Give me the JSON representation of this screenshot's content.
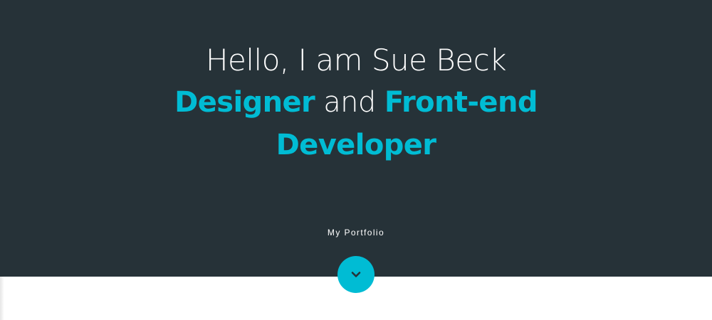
{
  "hero": {
    "greeting": "Hello, I am Sue Beck",
    "role_primary": "Designer",
    "connector": "and",
    "role_secondary": "Front-end Developer",
    "portfolio_label": "My Portfolio",
    "scroll_button_icon": "chevron-down-icon"
  },
  "colors": {
    "background": "#263238",
    "accent": "#00bcd4",
    "text": "#ffffff"
  }
}
